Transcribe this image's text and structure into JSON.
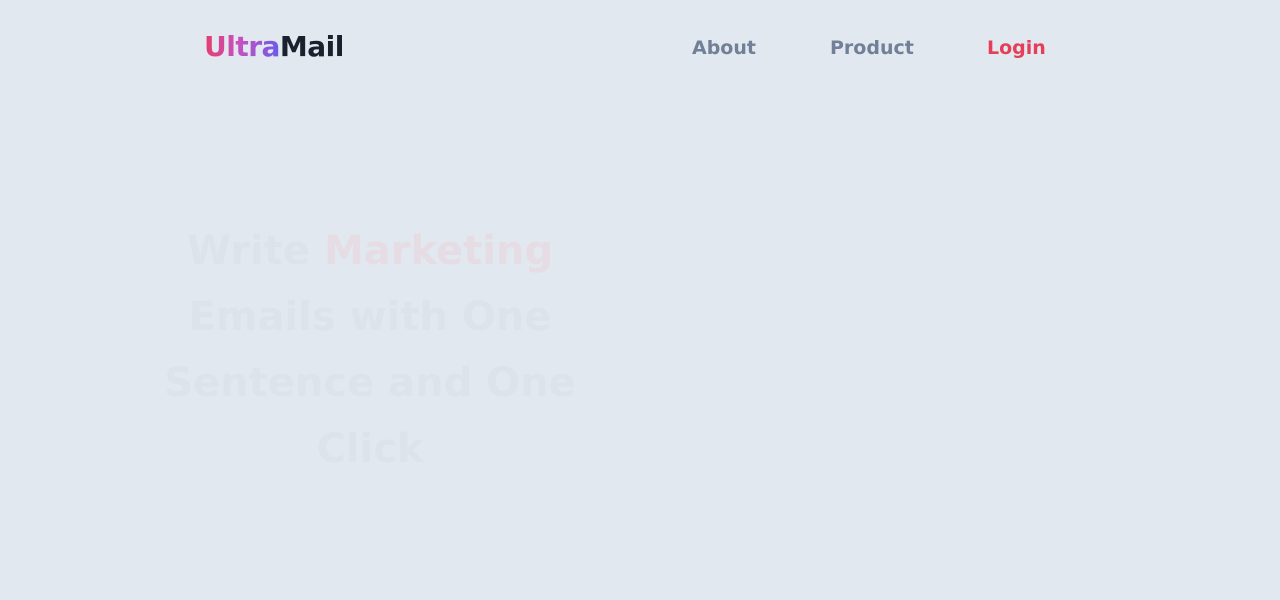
{
  "header": {
    "logo": {
      "part1": "Ultra",
      "part2": "Mail"
    },
    "nav": {
      "about": "About",
      "product": "Product",
      "login": "Login"
    }
  },
  "hero": {
    "headline_before": "Write ",
    "headline_accent": "Marketing",
    "headline_after": " Emails with One Sentence and One Click"
  },
  "colors": {
    "background": "#e2e8f0",
    "nav_text": "#718096",
    "login_accent": "#e53e57",
    "logo_dark": "#1a202c",
    "logo_gradient": [
      "#e53e6b",
      "#c850c0",
      "#6b5bea"
    ]
  }
}
